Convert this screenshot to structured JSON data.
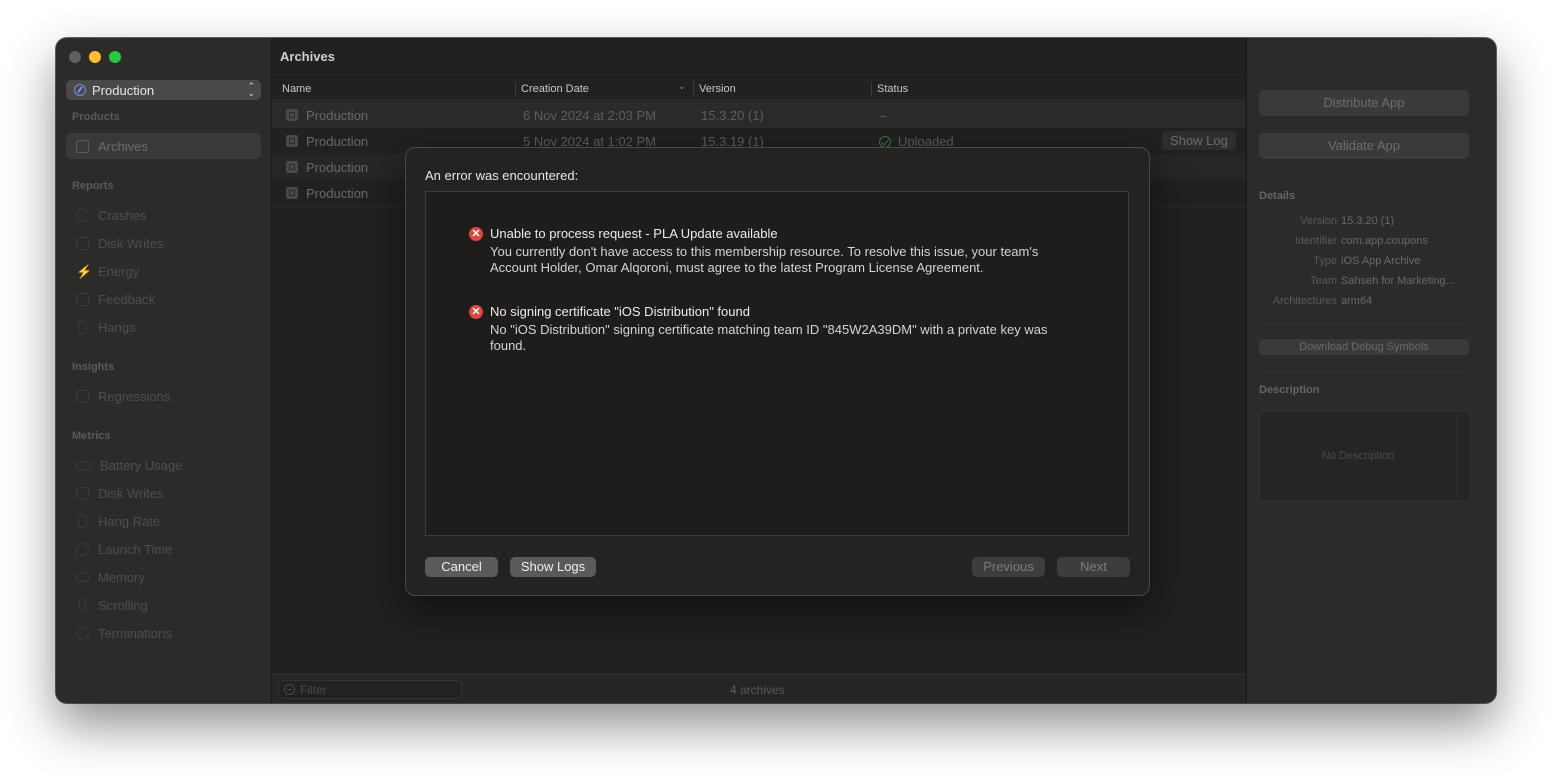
{
  "sidebar": {
    "scheme": "Production",
    "sections": [
      {
        "header": "Products",
        "items": [
          {
            "label": "Archives",
            "icon": "archive-icon"
          }
        ]
      },
      {
        "header": "Reports",
        "items": [
          {
            "label": "Crashes",
            "icon": "crash-icon"
          },
          {
            "label": "Disk Writes",
            "icon": "disk-icon"
          },
          {
            "label": "Energy",
            "icon": "bolt-icon"
          },
          {
            "label": "Feedback",
            "icon": "feedback-icon"
          },
          {
            "label": "Hangs",
            "icon": "hourglass-icon"
          }
        ]
      },
      {
        "header": "Insights",
        "items": [
          {
            "label": "Regressions",
            "icon": "bar-chart-icon"
          }
        ]
      },
      {
        "header": "Metrics",
        "items": [
          {
            "label": "Battery Usage",
            "icon": "battery-icon"
          },
          {
            "label": "Disk Writes",
            "icon": "disk-icon"
          },
          {
            "label": "Hang Rate",
            "icon": "hourglass-icon"
          },
          {
            "label": "Launch Time",
            "icon": "rocket-icon"
          },
          {
            "label": "Memory",
            "icon": "memory-icon"
          },
          {
            "label": "Scrolling",
            "icon": "scroll-icon"
          },
          {
            "label": "Terminations",
            "icon": "terminate-icon"
          }
        ]
      }
    ]
  },
  "main": {
    "title": "Archives",
    "columns": [
      "Name",
      "Creation Date",
      "Version",
      "Status"
    ],
    "rows": [
      {
        "name": "Production",
        "date": "6 Nov 2024 at 2:03 PM",
        "version": "15.3.20 (1)",
        "status": "–"
      },
      {
        "name": "Production",
        "date": "5 Nov 2024 at 1:02 PM",
        "version": "15.3.19 (1)",
        "status": "Uploaded",
        "show_log": "Show Log"
      },
      {
        "name": "Production",
        "date": "",
        "version": "",
        "status": ""
      },
      {
        "name": "Production",
        "date": "",
        "version": "",
        "status": ""
      }
    ],
    "filter_placeholder": "Filter",
    "archive_count": "4 archives"
  },
  "inspector": {
    "distribute_label": "Distribute App",
    "validate_label": "Validate App",
    "details_header": "Details",
    "details": [
      {
        "key": "Version",
        "value": "15.3.20 (1)"
      },
      {
        "key": "Identifier",
        "value": "com.app.coupons"
      },
      {
        "key": "Type",
        "value": "iOS App Archive"
      },
      {
        "key": "Team",
        "value": "Sahseh for Marketing..."
      },
      {
        "key": "Architectures",
        "value": "arm64"
      }
    ],
    "download_symbols_label": "Download Debug Symbols",
    "description_header": "Description",
    "description_placeholder": "No Description"
  },
  "sheet": {
    "title": "An error was encountered:",
    "errors": [
      {
        "title": "Unable to process request - PLA Update available",
        "description": "You currently don't have access to this membership resource. To resolve this issue, your team's Account Holder, Omar Alqoroni, must agree to the latest Program License Agreement."
      },
      {
        "title": "No signing certificate \"iOS Distribution\" found",
        "description": "No \"iOS Distribution\" signing certificate matching team ID \"845W2A39DM\" with a private key was found."
      }
    ],
    "cancel_label": "Cancel",
    "show_logs_label": "Show Logs",
    "previous_label": "Previous",
    "next_label": "Next"
  }
}
